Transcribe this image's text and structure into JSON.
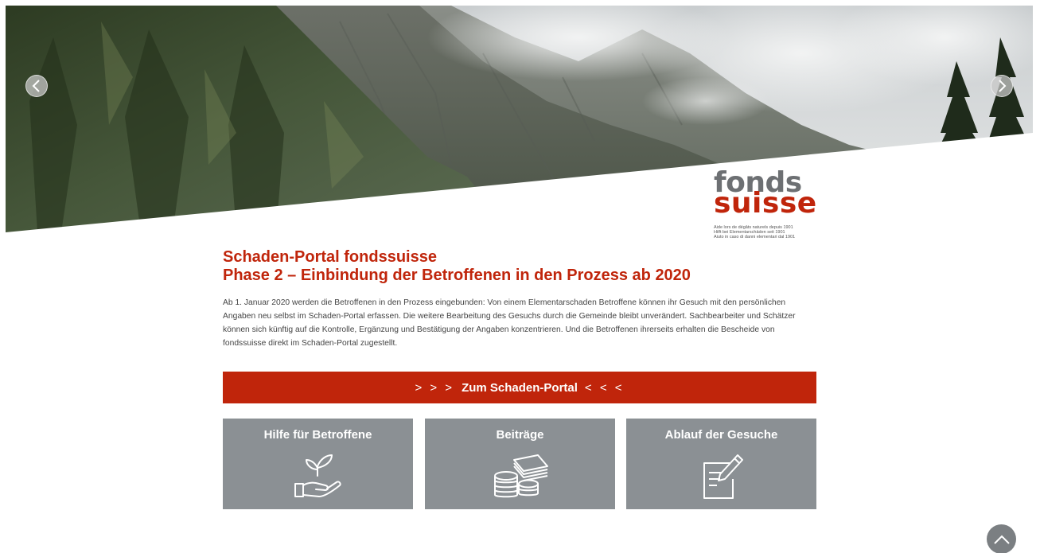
{
  "logo": {
    "word1": "fonds",
    "word2": "suisse",
    "taglines": [
      "Aide lors de dégâts naturels depuis 1901",
      "Hilft bei Elementarschäden seit 1901",
      "Aiuto in caso di danni elementari dal 1901"
    ]
  },
  "carousel": {
    "prev_icon": "chevron-left-icon",
    "next_icon": "chevron-right-icon"
  },
  "main": {
    "title_line1": "Schaden-Portal fondssuisse",
    "title_line2": "Phase 2 – Einbindung der Betroffenen in den Prozess ab 2020",
    "intro": "Ab 1. Januar 2020 werden die Betroffenen in den Prozess eingebunden: Von einem Elementarschaden Betroffene können ihr Gesuch mit den persönlichen Angaben neu selbst im Schaden-Portal erfassen. Die weitere Bearbeitung des Gesuchs durch die Gemeinde bleibt unverändert. Sachbearbeiter und Schätzer können sich künftig auf die Kontrolle, Ergänzung und Bestätigung der Angaben konzentrieren. Und die Betroffenen ihrerseits erhalten die Bescheide von fondssuisse direkt im Schaden-Portal zugestellt."
  },
  "portal_button": {
    "arrows_left": "> > >",
    "label": "Zum Schaden-Portal",
    "arrows_right": "< < <"
  },
  "tiles": [
    {
      "label": "Hilfe für Betroffene",
      "icon": "plant-in-hand-icon"
    },
    {
      "label": "Beiträge",
      "icon": "money-stack-icon"
    },
    {
      "label": "Ablauf der Gesuche",
      "icon": "edit-document-icon"
    }
  ],
  "back_to_top": {
    "icon": "chevron-up-icon"
  },
  "colors": {
    "brand_red": "#c0250b",
    "tile_gray": "#8b9094",
    "logo_gray": "#6d7073"
  }
}
